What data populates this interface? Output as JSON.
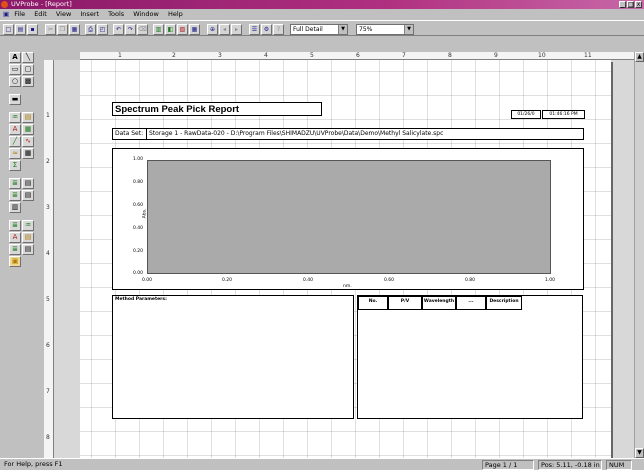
{
  "window": {
    "title": "UVProbe - [Report]",
    "min_label": "_",
    "max_label": "□",
    "close_label": "x"
  },
  "menu": [
    "File",
    "Edit",
    "View",
    "Insert",
    "Tools",
    "Window",
    "Help"
  ],
  "toolbar": {
    "full_detail": "Full Detail",
    "zoom": "75%"
  },
  "ruler": {
    "h": [
      "1",
      "2",
      "3",
      "4",
      "5",
      "6",
      "7",
      "8",
      "9",
      "10",
      "11"
    ],
    "v": [
      "1",
      "2",
      "3",
      "4",
      "5",
      "6",
      "7",
      "8"
    ]
  },
  "report": {
    "title": "Spectrum Peak Pick Report",
    "date": "01/26/0",
    "time": "01:46:16 PM",
    "dataset_label": "Data Set:",
    "dataset_value": "Storage 1 - RawData-020 - D:\\Program Files\\SHIMADZU\\UVProbe\\Data\\Demo\\Methyl Salicylate.spc",
    "ylabel": "Abs.",
    "xlabel": "nm.",
    "yticks": [
      "1.00",
      "0.80",
      "0.60",
      "0.40",
      "0.20",
      "0.00"
    ],
    "xticks": [
      "0.00",
      "0.20",
      "0.40",
      "0.60",
      "0.80",
      "1.00"
    ],
    "method_label": "Method Parameters:",
    "table_headers": [
      "No.",
      "P/V",
      "Wavelength",
      "...",
      "Description"
    ]
  },
  "status": {
    "help": "For Help, press F1",
    "page": "Page 1 / 1",
    "pos": "Pos: 5.11, -0.18 in",
    "num": "NUM"
  },
  "colors": {
    "title_bar_start": "#8a1868",
    "plot_bg": "#aaaaaa"
  }
}
